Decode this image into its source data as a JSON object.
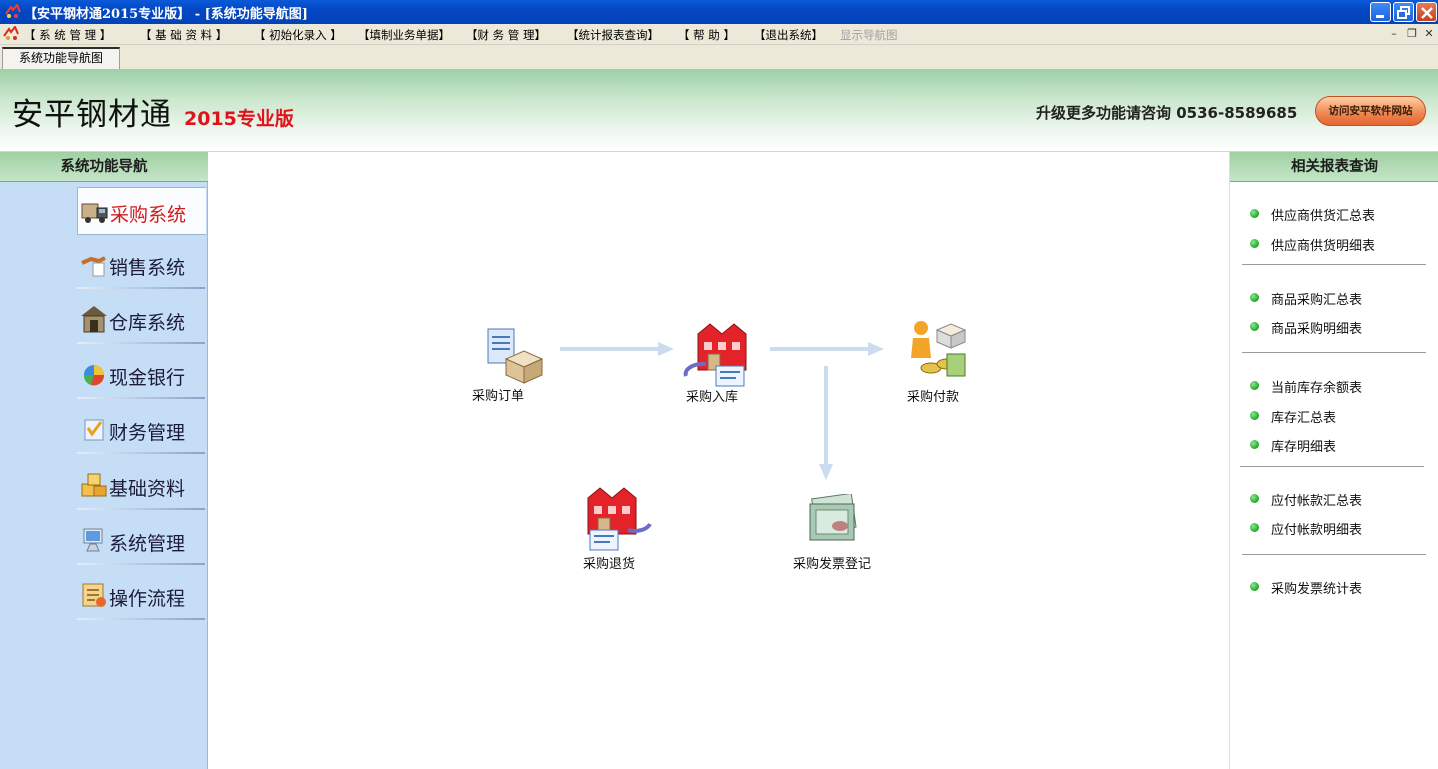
{
  "window": {
    "title": "【安平钢材通2015专业版】 - [系统功能导航图]",
    "controls": [
      "minimize",
      "restore",
      "close"
    ]
  },
  "menu": {
    "items": [
      "【 系 统 管 理 】",
      "【 基 础 资 料 】",
      "【 初始化录入 】",
      "【填制业务单据】",
      "【财 务 管 理】",
      "【统计报表查询】",
      "【 帮 助 】",
      "【退出系统】",
      "显示导航图"
    ],
    "disabled_item": "显示导航图"
  },
  "tabs": [
    {
      "label": "系统功能导航图",
      "active": true
    }
  ],
  "header": {
    "brand": "安平钢材通",
    "edition": "2015专业版",
    "contact": "升级更多功能请咨询  0536-8589685",
    "site_button": "访问安平软件网站"
  },
  "left_nav": {
    "title": "系统功能导航",
    "items": [
      {
        "label": "采购系统",
        "icon": "truck-icon",
        "active": true
      },
      {
        "label": "销售系统",
        "icon": "handshake-icon"
      },
      {
        "label": "仓库系统",
        "icon": "warehouse-icon"
      },
      {
        "label": "现金银行",
        "icon": "pie-chart-icon"
      },
      {
        "label": "财务管理",
        "icon": "finance-icon"
      },
      {
        "label": "基础资料",
        "icon": "boxes-icon"
      },
      {
        "label": "系统管理",
        "icon": "computer-icon"
      },
      {
        "label": "操作流程",
        "icon": "flow-icon"
      }
    ]
  },
  "flow": {
    "nodes": [
      {
        "label": "采购订单",
        "icon": "order-icon"
      },
      {
        "label": "采购入库",
        "icon": "warehouse-in-icon"
      },
      {
        "label": "采购付款",
        "icon": "payment-icon"
      },
      {
        "label": "采购退货",
        "icon": "return-icon"
      },
      {
        "label": "采购发票登记",
        "icon": "invoice-icon"
      }
    ]
  },
  "reports": {
    "title": "相关报表查询",
    "groups": [
      [
        "供应商供货汇总表",
        "供应商供货明细表"
      ],
      [
        "商品采购汇总表",
        "商品采购明细表"
      ],
      [
        "当前库存余额表",
        "库存汇总表",
        "库存明细表"
      ],
      [
        "应付帐款汇总表",
        "应付帐款明细表"
      ],
      [
        "采购发票统计表"
      ]
    ],
    "bullet_color": "#21a52a"
  },
  "colors": {
    "titlebar": "#0447c4",
    "panel_header": "#9fd0a3",
    "nav_bg": "#c6ddf6",
    "active_label": "#d11a1a",
    "edition": "#e0121a",
    "arrow": "#cbdcef"
  }
}
